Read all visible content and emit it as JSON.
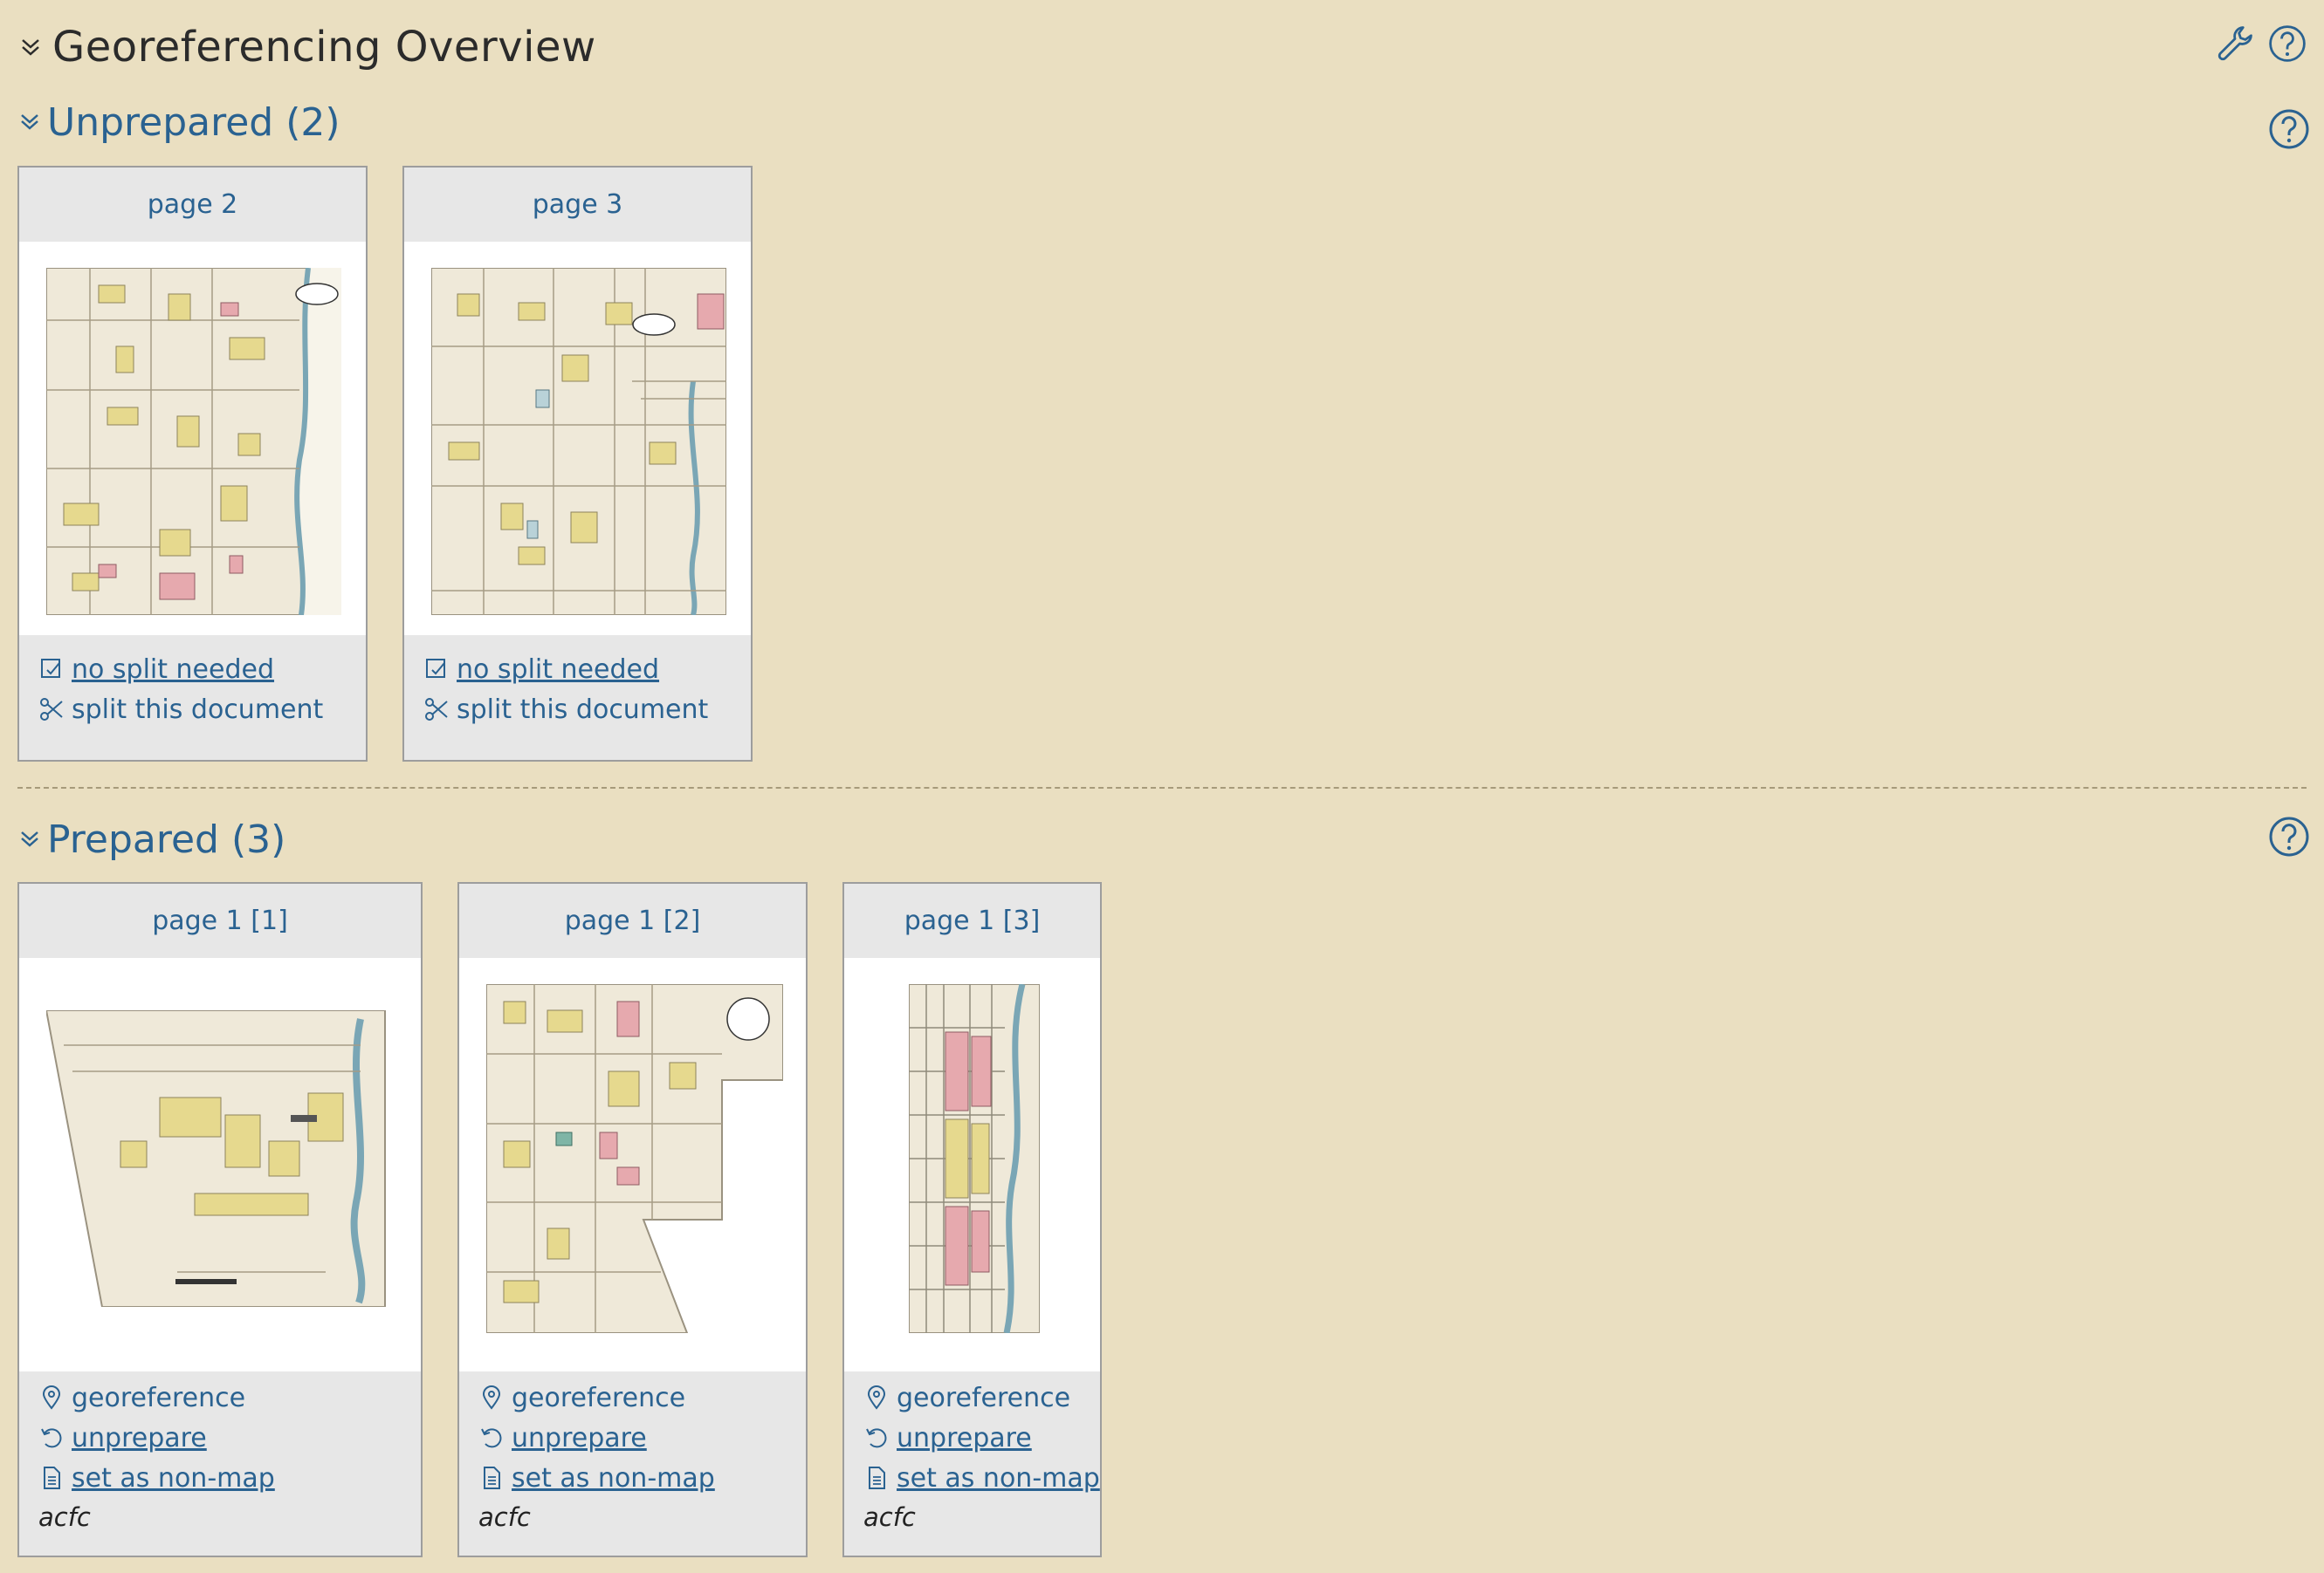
{
  "header": {
    "title": "Georeferencing Overview"
  },
  "sections": {
    "unprepared": {
      "title": "Unprepared (2)",
      "cards": [
        {
          "label": "page 2",
          "link1": " no split needed",
          "link2": " split this document"
        },
        {
          "label": "page 3",
          "link1": " no split needed",
          "link2": " split this document"
        }
      ]
    },
    "prepared": {
      "title": "Prepared (3)",
      "cards": [
        {
          "label": "page 1 [1]",
          "georeference": " georeference",
          "unprepare": "unprepare",
          "nonmap": " set as non-map",
          "owner": "acfc"
        },
        {
          "label": "page 1 [2]",
          "georeference": " georeference",
          "unprepare": "unprepare",
          "nonmap": " set as non-map",
          "owner": "acfc"
        },
        {
          "label": "page 1 [3]",
          "georeference": " georeference",
          "unprepare": "unprepare",
          "nonmap": " set as non-map",
          "owner": "acfc"
        }
      ]
    }
  },
  "icons": {
    "chevron": "chevron-double-down-icon",
    "tools": "wrench-icon",
    "help": "question-circle-icon",
    "no_split": "checkbox-icon",
    "split": "scissors-icon",
    "georeference": "map-pin-icon",
    "unprepare": "undo-icon",
    "nonmap": "document-icon"
  },
  "colors": {
    "background": "#eadfc1",
    "link": "#2a6291",
    "card": "#e7e7e7"
  }
}
